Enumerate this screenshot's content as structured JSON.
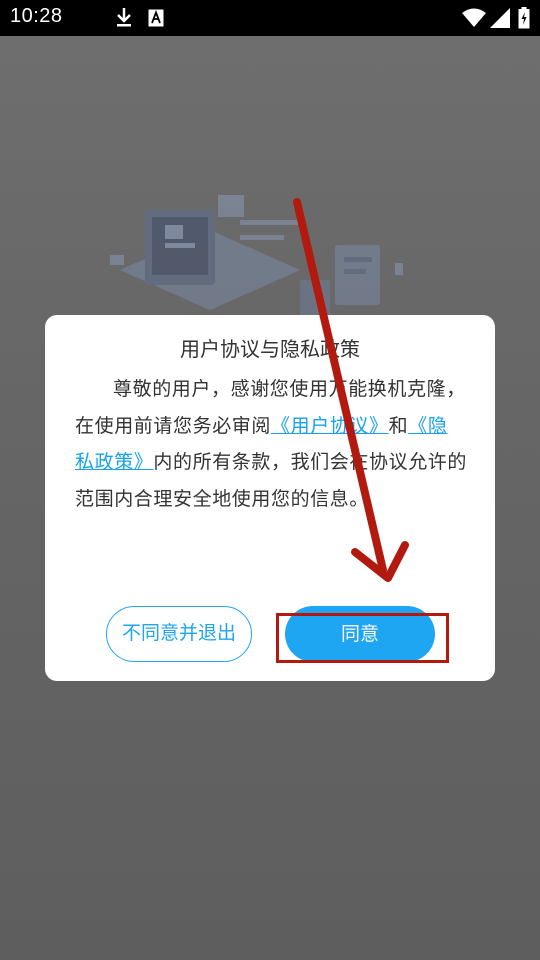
{
  "status_bar": {
    "time": "10:28",
    "icons": [
      "download-icon",
      "text-a-icon",
      "wifi-icon",
      "signal-icon",
      "battery-charging-icon"
    ]
  },
  "dialog": {
    "title": "用户协议与隐私政策",
    "body_1": "尊敬的用户，感谢您使用万能换机克隆，在使用前请您务必审阅",
    "link_user_agreement": "《用户协议》",
    "body_2": "和",
    "link_privacy_policy": "《隐私政策》",
    "body_3": "内的所有条款，我们会在协议允许的范围内合理安全地使用您的信息。",
    "decline_label": "不同意并退出",
    "agree_label": "同意"
  },
  "colors": {
    "accent": "#1ea6f2",
    "annotation_red": "#b21a0f",
    "overlay": "#6a6a6a"
  }
}
